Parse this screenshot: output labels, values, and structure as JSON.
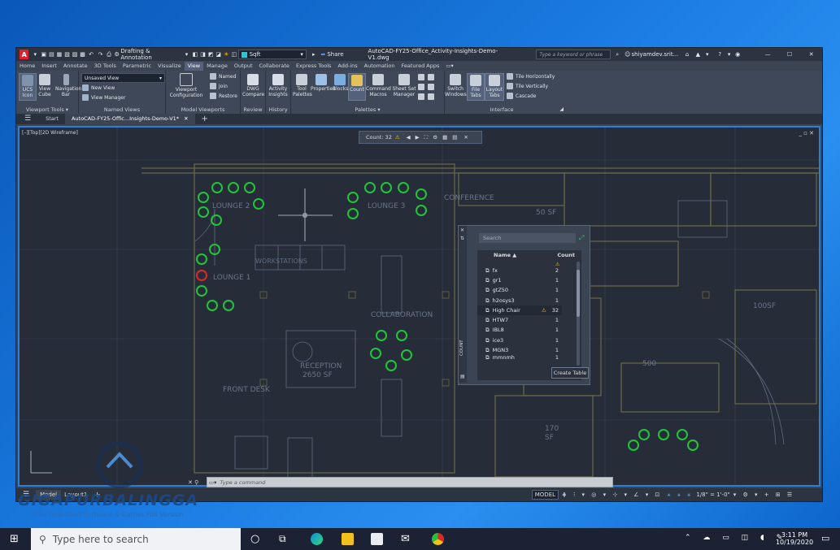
{
  "window": {
    "title": "AutoCAD-FY25-Office_Activity-Insights-Demo-V1.dwg",
    "workspace": "Drafting & Annotation",
    "layer_combo": "Sqft",
    "share_label": "Share",
    "search_placeholder": "Type a keyword or phrase",
    "user": "shiyamdev.srit..."
  },
  "menu": [
    "Home",
    "Insert",
    "Annotate",
    "3D Tools",
    "Parametric",
    "Visualize",
    "View",
    "Manage",
    "Output",
    "Collaborate",
    "Express Tools",
    "Add-ins",
    "Automation",
    "Featured Apps"
  ],
  "menu_active": "View",
  "ribbon": {
    "viewport_tools": {
      "title": "Viewport Tools",
      "ucs": "UCS Icon",
      "viewcube": "View Cube",
      "navbar": "Navigation Bar"
    },
    "named_views": {
      "title": "Named Views",
      "combo": "Unsaved View",
      "new_view": "New View",
      "view_manager": "View Manager"
    },
    "model_viewports": {
      "title": "Model Viewports",
      "config": "Viewport Configuration",
      "named": "Named",
      "join": "Join",
      "restore": "Restore"
    },
    "review": {
      "title": "Review",
      "dwg_compare": "DWG Compare"
    },
    "history": {
      "title": "History",
      "activity": "Activity Insights"
    },
    "palettes": {
      "title": "Palettes",
      "tool": "Tool Palettes",
      "properties": "Properties",
      "blocks": "Blocks",
      "count": "Count",
      "command_macros": "Command Macros",
      "sheet_set": "Sheet Set Manager"
    },
    "interface": {
      "title": "Interface",
      "switch": "Switch Windows",
      "file_tabs": "File Tabs",
      "layout_tabs": "Layout Tabs",
      "tile_h": "Tile Horizontally",
      "tile_v": "Tile Vertically",
      "cascade": "Cascade"
    }
  },
  "file_tabs": {
    "start": "Start",
    "doc": "AutoCAD-FY25-Offic...Insights-Demo-V1*"
  },
  "viewport": {
    "label": "[–][Top][2D Wireframe]",
    "count_label": "Count: 32"
  },
  "rooms": {
    "lounge2": "LOUNGE 2",
    "lounge3": "LOUNGE 3",
    "lounge1": "LOUNGE 1",
    "conference": "CONFERENCE",
    "collab": "COLLABORATION",
    "reception": "RECEPTION",
    "reception_sf": "2650 SF",
    "front_desk": "FRONT DESK",
    "sf50": "50 SF",
    "sf500": "500",
    "sf100": "100SF",
    "sf170": "170",
    "sf_small": "SF",
    "ws": "WORKSTATIONS"
  },
  "count_panel": {
    "search_placeholder": "Search",
    "col_name": "Name ▲",
    "col_count": "Count",
    "vertical_label": "COUNT",
    "create_table": "Create Table",
    "rows": [
      {
        "name": "fx",
        "count": "2"
      },
      {
        "name": "gr1",
        "count": "1"
      },
      {
        "name": "gtZ50",
        "count": "1"
      },
      {
        "name": "h2osys3",
        "count": "1"
      },
      {
        "name": "High Chair",
        "count": "32"
      },
      {
        "name": "HTW7",
        "count": "1"
      },
      {
        "name": "IBL8",
        "count": "1"
      },
      {
        "name": "ice3",
        "count": "1"
      },
      {
        "name": "MGN3",
        "count": "1"
      },
      {
        "name": "mmnmh",
        "count": "1"
      }
    ]
  },
  "command": {
    "placeholder": "Type a command"
  },
  "status": {
    "model_tab": "Model",
    "layout_tab": "Layout1",
    "model": "MODEL",
    "scale": "1/8\" = 1'-0\""
  },
  "taskbar": {
    "search": "Type here to search",
    "time": "3:11 PM",
    "date": "10/19/2020"
  },
  "watermark": {
    "brand": "GIGAPURBALINGGA",
    "tagline": "Free Download Software & Games Full Version"
  },
  "colors": {
    "accent": "#2b7fd8",
    "chair_ok": "#22c43a",
    "chair_warn": "#e0282c",
    "warning": "#f2c21b",
    "autocad_red": "#d9232e"
  }
}
